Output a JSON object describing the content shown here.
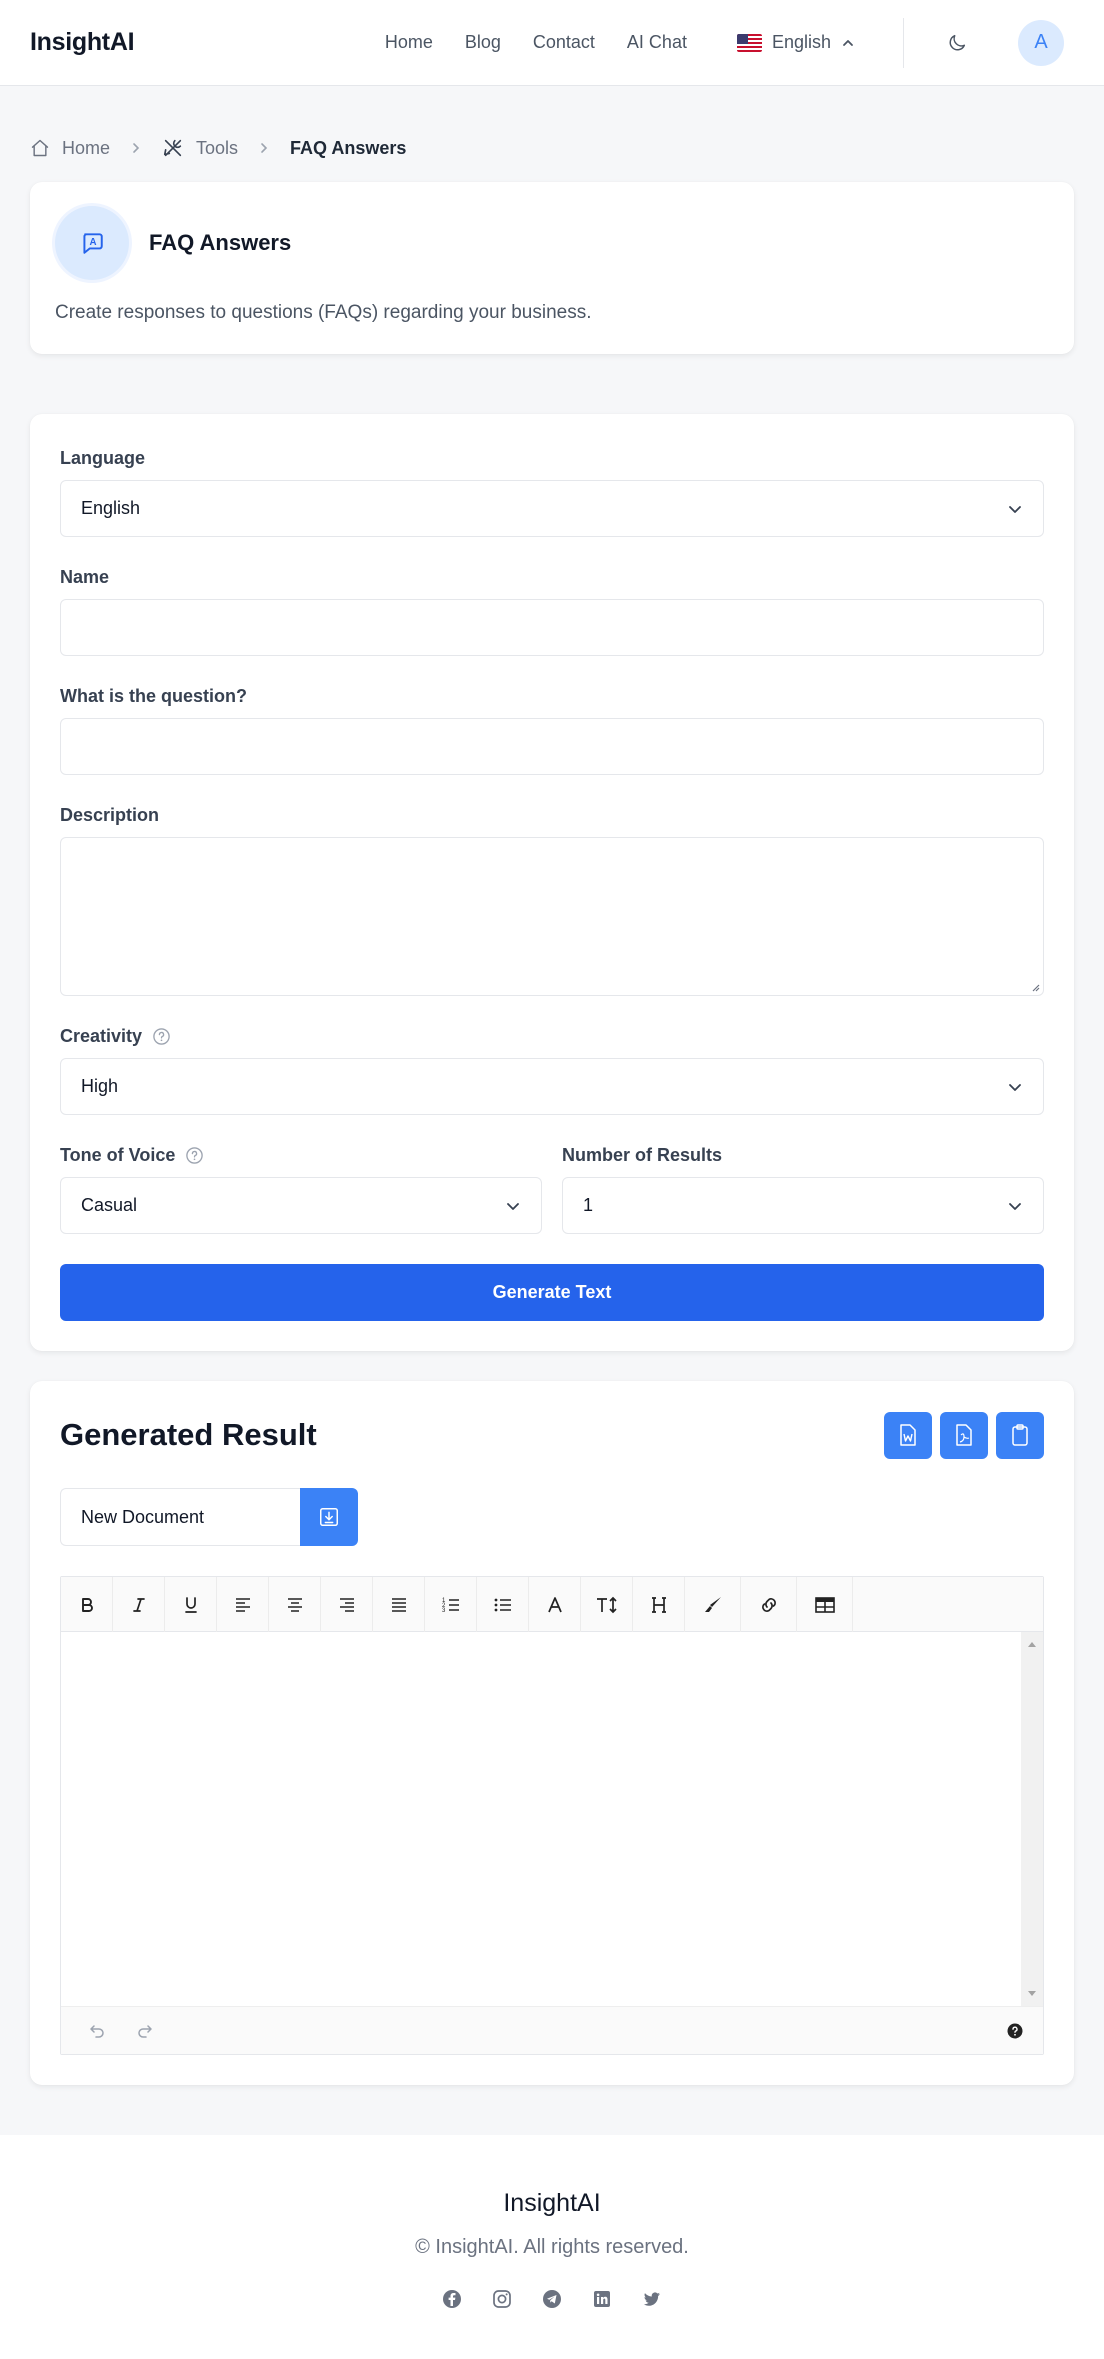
{
  "header": {
    "logo": "InsightAI",
    "nav": [
      "Home",
      "Blog",
      "Contact",
      "AI Chat"
    ],
    "language": "English",
    "avatar_initial": "A"
  },
  "breadcrumb": {
    "home": "Home",
    "tools": "Tools",
    "current": "FAQ Answers"
  },
  "tool": {
    "title": "FAQ Answers",
    "description": "Create responses to questions (FAQs) regarding your business."
  },
  "form": {
    "language_label": "Language",
    "language_value": "English",
    "name_label": "Name",
    "name_value": "",
    "question_label": "What is the question?",
    "question_value": "",
    "description_label": "Description",
    "description_value": "",
    "creativity_label": "Creativity",
    "creativity_value": "High",
    "tone_label": "Tone of Voice",
    "tone_value": "Casual",
    "results_label": "Number of Results",
    "results_value": "1",
    "generate_label": "Generate Text"
  },
  "result": {
    "title": "Generated Result",
    "document_name": "New Document",
    "toolbar_icons": [
      "bold-icon",
      "italic-icon",
      "underline-icon",
      "align-left-icon",
      "align-center-icon",
      "align-right-icon",
      "align-justify-icon",
      "ordered-list-icon",
      "unordered-list-icon",
      "font-color-icon",
      "font-size-icon",
      "heading-icon",
      "highlight-icon",
      "link-icon",
      "table-icon"
    ]
  },
  "footer": {
    "brand": "InsightAI",
    "copyright": "© InsightAI. All rights reserved.",
    "socials": [
      "facebook-icon",
      "instagram-icon",
      "telegram-icon",
      "linkedin-icon",
      "twitter-icon"
    ]
  },
  "colors": {
    "primary": "#2563eb",
    "icon_button": "#3b82f6",
    "avatar_bg": "#dbeafe",
    "page_bg": "#f6f7f9"
  }
}
